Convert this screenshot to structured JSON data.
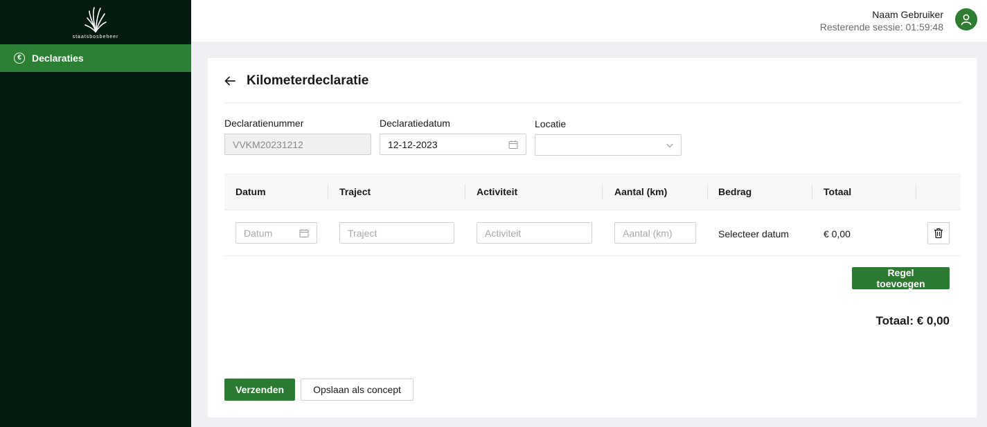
{
  "brand": {
    "name": "staatsbosbeheer"
  },
  "sidebar": {
    "items": [
      {
        "label": "Declaraties",
        "icon": "euro-icon"
      }
    ]
  },
  "header": {
    "user_name": "Naam Gebruiker",
    "session": "Resterende sessie: 01:59:48"
  },
  "page": {
    "title": "Kilometerdeclaratie"
  },
  "form": {
    "number_label": "Declaratienummer",
    "number_value": "VVKM20231212",
    "date_label": "Declaratiedatum",
    "date_value": "12-12-2023",
    "location_label": "Locatie",
    "location_value": ""
  },
  "table": {
    "columns": [
      "Datum",
      "Traject",
      "Activiteit",
      "Aantal (km)",
      "Bedrag",
      "Totaal"
    ],
    "rows": [
      {
        "date_placeholder": "Datum",
        "route_placeholder": "Traject",
        "activity_placeholder": "Activiteit",
        "km_placeholder": "Aantal (km)",
        "amount": "Selecteer datum",
        "total": "€ 0,00"
      }
    ]
  },
  "actions": {
    "add_row": "Regel toevoegen",
    "submit": "Verzenden",
    "save_draft": "Opslaan als concept"
  },
  "summary": {
    "total": "Totaal: € 0,00"
  },
  "colors": {
    "sidebar_bg": "#051b0f",
    "accent": "#2c8033",
    "button": "#2c7a31"
  }
}
